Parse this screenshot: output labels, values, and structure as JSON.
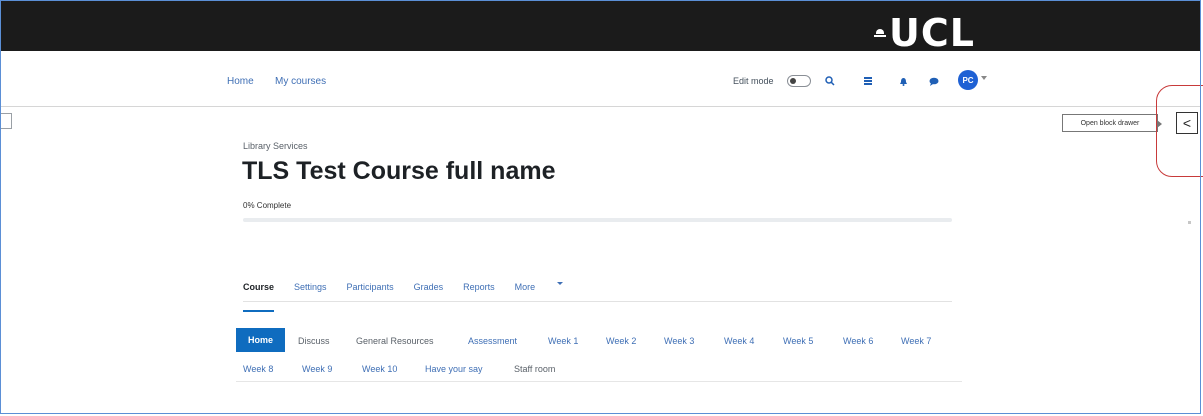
{
  "header": {
    "logo_text": "UCL"
  },
  "nav": {
    "home": "Home",
    "my_courses": "My courses",
    "edit_mode": "Edit mode",
    "avatar_initials": "PC"
  },
  "drawer": {
    "tooltip": "Open block drawer",
    "button_glyph": "<"
  },
  "course": {
    "category": "Library Services",
    "title": "TLS Test Course full name",
    "completion": "0% Complete",
    "progress_percent": 0
  },
  "tabs": [
    {
      "label": "Course",
      "active": true
    },
    {
      "label": "Settings"
    },
    {
      "label": "Participants"
    },
    {
      "label": "Grades"
    },
    {
      "label": "Reports"
    },
    {
      "label": "More"
    }
  ],
  "sections": {
    "home": "Home",
    "row1": [
      "Discuss",
      "General Resources",
      "Assessment",
      "Week 1",
      "Week 2",
      "Week 3",
      "Week 4",
      "Week 5",
      "Week 6",
      "Week 7"
    ],
    "row2": [
      "Week 8",
      "Week 9",
      "Week 10",
      "Have your say",
      "Staff room"
    ]
  },
  "icons": [
    "search-icon",
    "grid-icon",
    "bell-icon",
    "chat-icon",
    "chevron-left-icon"
  ],
  "colors": {
    "accent": "#0f6cbf",
    "link": "#3f6fb5",
    "banner": "#1b1b1b",
    "highlight": "#c83a3a"
  }
}
